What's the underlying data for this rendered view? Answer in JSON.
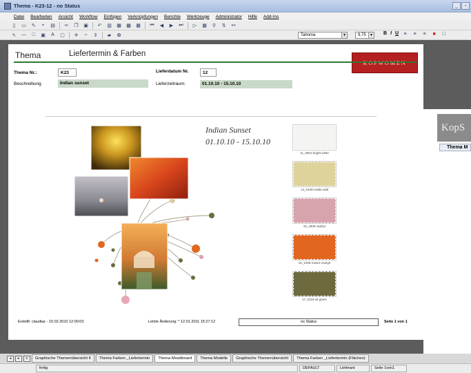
{
  "window": {
    "title": "Thema - K23-12 - no Status",
    "min_label": "_",
    "max_label": "▫"
  },
  "menu": [
    "Datei",
    "Bearbeiten",
    "Ansicht",
    "Workflow",
    "Einfügen",
    "Verknüpfungen",
    "Berichte",
    "Werkzeuge",
    "Administrator",
    "Hilfe",
    "Add-Ins"
  ],
  "toolbar": {
    "font_name": "Tahoma",
    "font_size": "9,75",
    "bold_label": "B",
    "italic_label": "I",
    "underline_label": "U"
  },
  "document": {
    "title": "Thema",
    "subtitle": "Liefertermin & Farben",
    "brand": "KopWomen",
    "theme_nr_label": "Thema Nr.:",
    "theme_nr": "K23",
    "description_label": "Beschreibung",
    "description": "Indian sunset",
    "delivery_nr_label": "Lieferdatum Nr.",
    "delivery_nr": "12",
    "delivery_period_label": "Lieferzeitraum:",
    "delivery_period": "01.10.10 - 15.10.10",
    "moodboard_title": "Indian Sunset",
    "moodboard_dates": "01.10.10 - 15.10.10",
    "swatches": [
      {
        "label": "11_0601-bright white",
        "color": "#f4f4f2"
      },
      {
        "label": "14_0108-castle wall",
        "color": "#dfd39c"
      },
      {
        "label": "15_1906-zephyr",
        "color": "#d7a3ad"
      },
      {
        "label": "16_1255-russet orange",
        "color": "#e2661f"
      },
      {
        "label": "17_0115-oil green",
        "color": "#6d6a3e"
      }
    ],
    "created": "Erstellt: claudiaz - 10.02.2010 12:00:03",
    "last_change": "Letzte Änderung: * 12.01.2011 15:27:12",
    "status": "no Status",
    "page_info": "Seite 1 von 1"
  },
  "peek": {
    "logo_text": "KopS",
    "tab_label": "Thema M"
  },
  "tabs": [
    {
      "label": "Graphische Themenübersicht II",
      "active": false
    },
    {
      "label": "Thema Farben _Liefertermin",
      "active": false
    },
    {
      "label": "Thema Moodboard",
      "active": true
    },
    {
      "label": "Thema Modelle",
      "active": false
    },
    {
      "label": "Graphische Themenübersicht",
      "active": false
    },
    {
      "label": "Thema Farben _Liefertermin (Flächen)",
      "active": false
    }
  ],
  "statusbar": {
    "ready": "fertig",
    "locale": "DEFAULT",
    "role": "Lieferant",
    "page": "Seite 1von1"
  }
}
